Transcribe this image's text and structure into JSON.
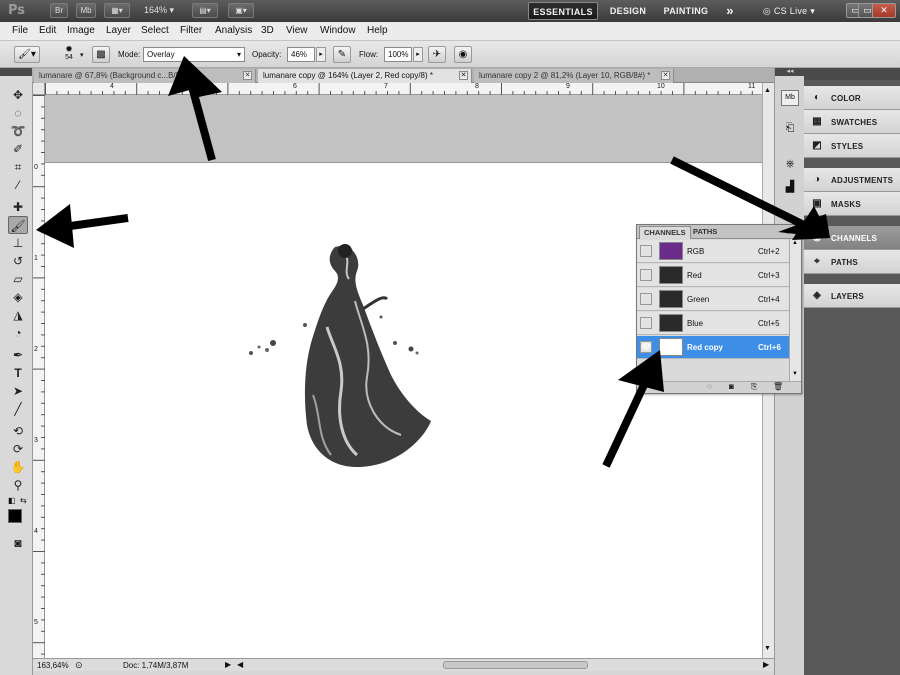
{
  "titlebar": {
    "app_logo": "Ps",
    "br_button": "Br",
    "mb_button": "Mb",
    "zoom": "164%",
    "workspaces": [
      "ESSENTIALS",
      "DESIGN",
      "PAINTING"
    ],
    "more": "»",
    "cslive": "CS Live",
    "window_controls": [
      "▭",
      "▭",
      "✕"
    ]
  },
  "menu": [
    "File",
    "Edit",
    "Image",
    "Layer",
    "Select",
    "Filter",
    "Analysis",
    "3D",
    "View",
    "Window",
    "Help"
  ],
  "options": {
    "brush_size": "54",
    "mode_label": "Mode:",
    "mode_value": "Overlay",
    "opacity_label": "Opacity:",
    "opacity_value": "46%",
    "flow_label": "Flow:",
    "flow_value": "100%"
  },
  "tabs": [
    {
      "label": "lumanare @ 67,8% (Background c...B/8#) *",
      "active": false
    },
    {
      "label": "lumanare copy @ 164% (Layer 2, Red copy/8) *",
      "active": true
    },
    {
      "label": "lumanare copy 2 @ 81,2% (Layer 10, RGB/8#) *",
      "active": false
    }
  ],
  "ruler_top": [
    "4",
    "5",
    "6",
    "7",
    "8",
    "9",
    "10",
    "11"
  ],
  "ruler_left": [
    "0",
    "1",
    "2",
    "3",
    "4",
    "5"
  ],
  "status": {
    "zoom": "163,64%",
    "doc": "Doc: 1,74M/3,87M"
  },
  "dock": {
    "items": [
      {
        "icon": "color-icon",
        "label": "COLOR"
      },
      {
        "icon": "swatches-icon",
        "label": "SWATCHES"
      },
      {
        "icon": "styles-icon",
        "label": "STYLES"
      },
      {
        "icon": "adjustments-icon",
        "label": "ADJUSTMENTS"
      },
      {
        "icon": "masks-icon",
        "label": "MASKS"
      },
      {
        "icon": "channels-icon",
        "label": "CHANNELS",
        "active": true
      },
      {
        "icon": "paths-icon",
        "label": "PATHS"
      },
      {
        "icon": "layers-icon",
        "label": "LAYERS"
      }
    ]
  },
  "channels": {
    "tabs": [
      "CHANNELS",
      "PATHS"
    ],
    "rows": [
      {
        "name": "RGB",
        "shortcut": "Ctrl+2",
        "visible": false,
        "thumb": "#7a2a9a"
      },
      {
        "name": "Red",
        "shortcut": "Ctrl+3",
        "visible": false,
        "thumb": "#333333"
      },
      {
        "name": "Green",
        "shortcut": "Ctrl+4",
        "visible": false,
        "thumb": "#2d2d2d"
      },
      {
        "name": "Blue",
        "shortcut": "Ctrl+5",
        "visible": false,
        "thumb": "#3a3a3a"
      },
      {
        "name": "Red copy",
        "shortcut": "Ctrl+6",
        "visible": true,
        "selected": true,
        "thumb": "#ffffff"
      }
    ]
  },
  "colors": {
    "accent_selected": "#3d8ee6",
    "titlebar": "#4a4a4a",
    "dock_bg": "#595959"
  }
}
